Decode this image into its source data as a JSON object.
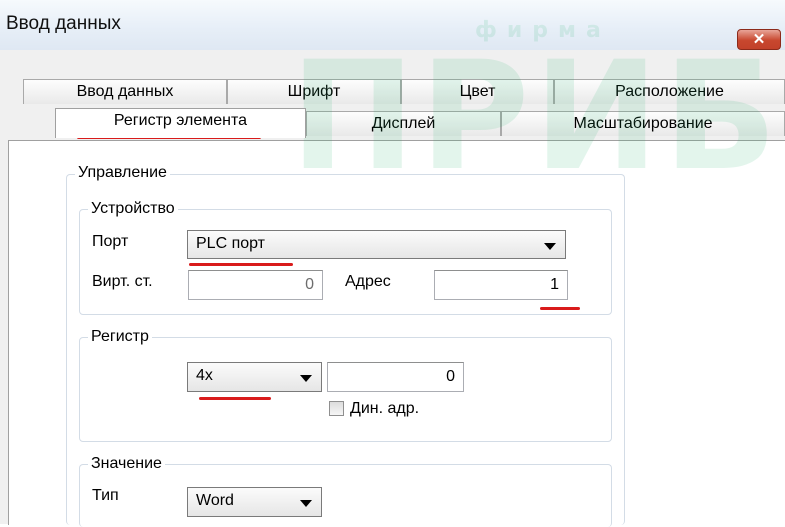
{
  "window": {
    "title": "Ввод данных",
    "close_glyph": "✕"
  },
  "tabs_row1": [
    "Ввод данных",
    "Шрифт",
    "Цвет",
    "Расположение"
  ],
  "tabs_row2": [
    "Регистр элемента",
    "Дисплей",
    "Масштабирование"
  ],
  "control": {
    "label": "Управление",
    "device": {
      "label": "Устройство",
      "port_label": "Порт",
      "port_value": "PLC порт",
      "virt_label": "Вирт. ст.",
      "virt_value": "0",
      "addr_label": "Адрес",
      "addr_value": "1"
    },
    "register": {
      "label": "Регистр",
      "type_value": "4x",
      "reg_value": "0",
      "dyn_label": "Дин. адр.",
      "dyn_checked": false
    },
    "value": {
      "label": "Значение",
      "type_label": "Тип",
      "type_value": "Word"
    }
  },
  "watermark": {
    "text1": "фирма",
    "text2": "ПРИБОР"
  },
  "colors": {
    "annotation_red": "#d91b1b",
    "close_red": "#c8472e",
    "watermark_green": "#21b26c"
  }
}
